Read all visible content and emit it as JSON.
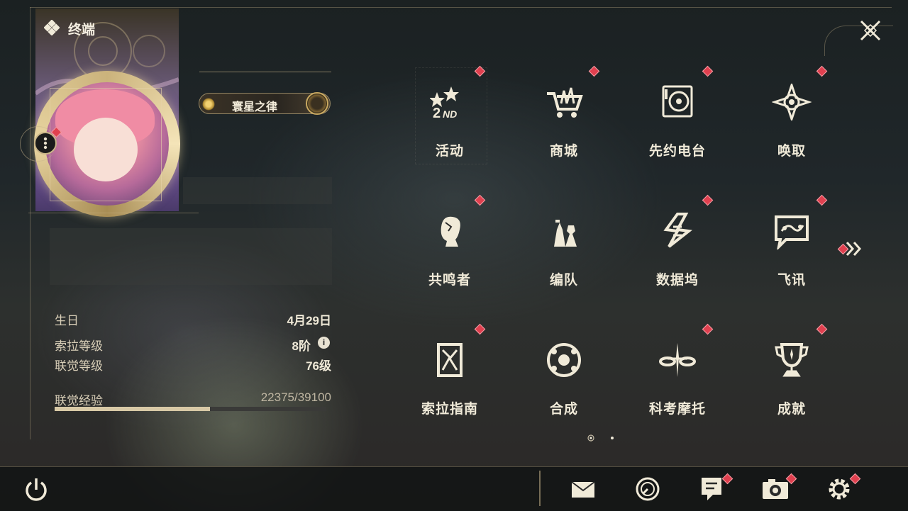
{
  "header": {
    "title": "终端"
  },
  "profile": {
    "title_badge": "寰星之律",
    "stats": [
      {
        "label": "生日",
        "value": "4月29日"
      },
      {
        "label": "索拉等级",
        "value": "8阶"
      },
      {
        "label": "联觉等级",
        "value": "76级"
      }
    ],
    "xp": {
      "label": "联觉经验",
      "value": "22375/39100",
      "current": 22375,
      "max": 39100
    }
  },
  "menu": {
    "items": [
      {
        "label": "活动",
        "icon": "event-icon",
        "badge": true
      },
      {
        "label": "商城",
        "icon": "shop-icon",
        "badge": true
      },
      {
        "label": "先约电台",
        "icon": "radio-icon",
        "badge": true
      },
      {
        "label": "唤取",
        "icon": "convene-icon",
        "badge": true
      },
      {
        "label": "共鸣者",
        "icon": "resonator-icon",
        "badge": true
      },
      {
        "label": "编队",
        "icon": "team-icon",
        "badge": false
      },
      {
        "label": "数据坞",
        "icon": "data-bank-icon",
        "badge": true
      },
      {
        "label": "飞讯",
        "icon": "message-icon",
        "badge": true
      },
      {
        "label": "索拉指南",
        "icon": "guide-icon",
        "badge": true
      },
      {
        "label": "合成",
        "icon": "synthesis-icon",
        "badge": false
      },
      {
        "label": "科考摩托",
        "icon": "motorbike-icon",
        "badge": true
      },
      {
        "label": "成就",
        "icon": "trophy-icon",
        "badge": true
      }
    ],
    "page_current": 1,
    "page_total": 2
  },
  "bottom_bar": {
    "icons": [
      "mail-icon",
      "clock-icon",
      "notes-icon",
      "camera-icon",
      "settings-icon"
    ]
  },
  "colors": {
    "accent": "#c8b488",
    "badge_red": "#e0404f"
  }
}
